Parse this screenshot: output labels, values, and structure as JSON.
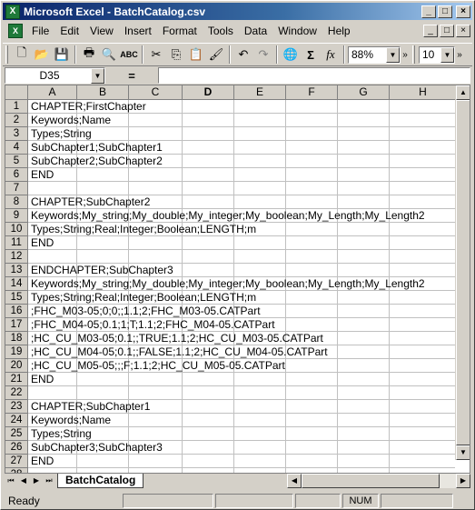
{
  "window": {
    "title": "Microsoft Excel - BatchCatalog.csv",
    "minimize": "_",
    "maximize": "□",
    "close": "×"
  },
  "menu": {
    "items": [
      "File",
      "Edit",
      "View",
      "Insert",
      "Format",
      "Tools",
      "Data",
      "Window",
      "Help"
    ]
  },
  "toolbar": {
    "zoom": "88%",
    "font_size": "10",
    "icons": [
      "new-icon",
      "open-icon",
      "save-icon",
      "print-icon",
      "print-preview-icon",
      "spelling-icon",
      "cut-icon",
      "copy-icon",
      "paste-icon",
      "format-painter-icon",
      "undo-icon",
      "redo-icon",
      "hyperlink-icon",
      "autosum-icon",
      "function-icon"
    ]
  },
  "formula_bar": {
    "name_box": "D35",
    "equals": "=",
    "content": ""
  },
  "grid": {
    "columns": [
      "A",
      "B",
      "C",
      "D",
      "E",
      "F",
      "G",
      "H"
    ],
    "active_column": "D",
    "rows": [
      {
        "n": "1",
        "a": "CHAPTER;FirstChapter"
      },
      {
        "n": "2",
        "a": "Keywords;Name"
      },
      {
        "n": "3",
        "a": "Types;String"
      },
      {
        "n": "4",
        "a": "SubChapter1;SubChapter1"
      },
      {
        "n": "5",
        "a": "SubChapter2;SubChapter2"
      },
      {
        "n": "6",
        "a": "END"
      },
      {
        "n": "7",
        "a": ""
      },
      {
        "n": "8",
        "a": "CHAPTER;SubChapter2"
      },
      {
        "n": "9",
        "a": "Keywords;My_string;My_double;My_integer;My_boolean;My_Length;My_Length2"
      },
      {
        "n": "10",
        "a": "Types;String;Real;Integer;Boolean;LENGTH;m"
      },
      {
        "n": "11",
        "a": "END"
      },
      {
        "n": "12",
        "a": ""
      },
      {
        "n": "13",
        "a": "ENDCHAPTER;SubChapter3"
      },
      {
        "n": "14",
        "a": "Keywords;My_string;My_double;My_integer;My_boolean;My_Length;My_Length2"
      },
      {
        "n": "15",
        "a": "Types;String;Real;Integer;Boolean;LENGTH;m"
      },
      {
        "n": "16",
        "a": ";FHC_M03-05;0;0;;1.1;2;FHC_M03-05.CATPart"
      },
      {
        "n": "17",
        "a": ";FHC_M04-05;0.1;1;T;1.1;2;FHC_M04-05.CATPart"
      },
      {
        "n": "18",
        "a": ";HC_CU_M03-05;0.1;;TRUE;1.1;2;HC_CU_M03-05.CATPart"
      },
      {
        "n": "19",
        "a": ";HC_CU_M04-05;0.1;;FALSE;1.1;2;HC_CU_M04-05.CATPart"
      },
      {
        "n": "20",
        "a": ";HC_CU_M05-05;;;F;1.1;2;HC_CU_M05-05.CATPart"
      },
      {
        "n": "21",
        "a": "END"
      },
      {
        "n": "22",
        "a": ""
      },
      {
        "n": "23",
        "a": "CHAPTER;SubChapter1"
      },
      {
        "n": "24",
        "a": "Keywords;Name"
      },
      {
        "n": "25",
        "a": "Types;String"
      },
      {
        "n": "26",
        "a": "SubChapter3;SubChapter3"
      },
      {
        "n": "27",
        "a": "END"
      },
      {
        "n": "28",
        "a": ""
      }
    ]
  },
  "sheet_tabs": [
    "BatchCatalog"
  ],
  "status": {
    "text": "Ready",
    "num": "NUM"
  }
}
